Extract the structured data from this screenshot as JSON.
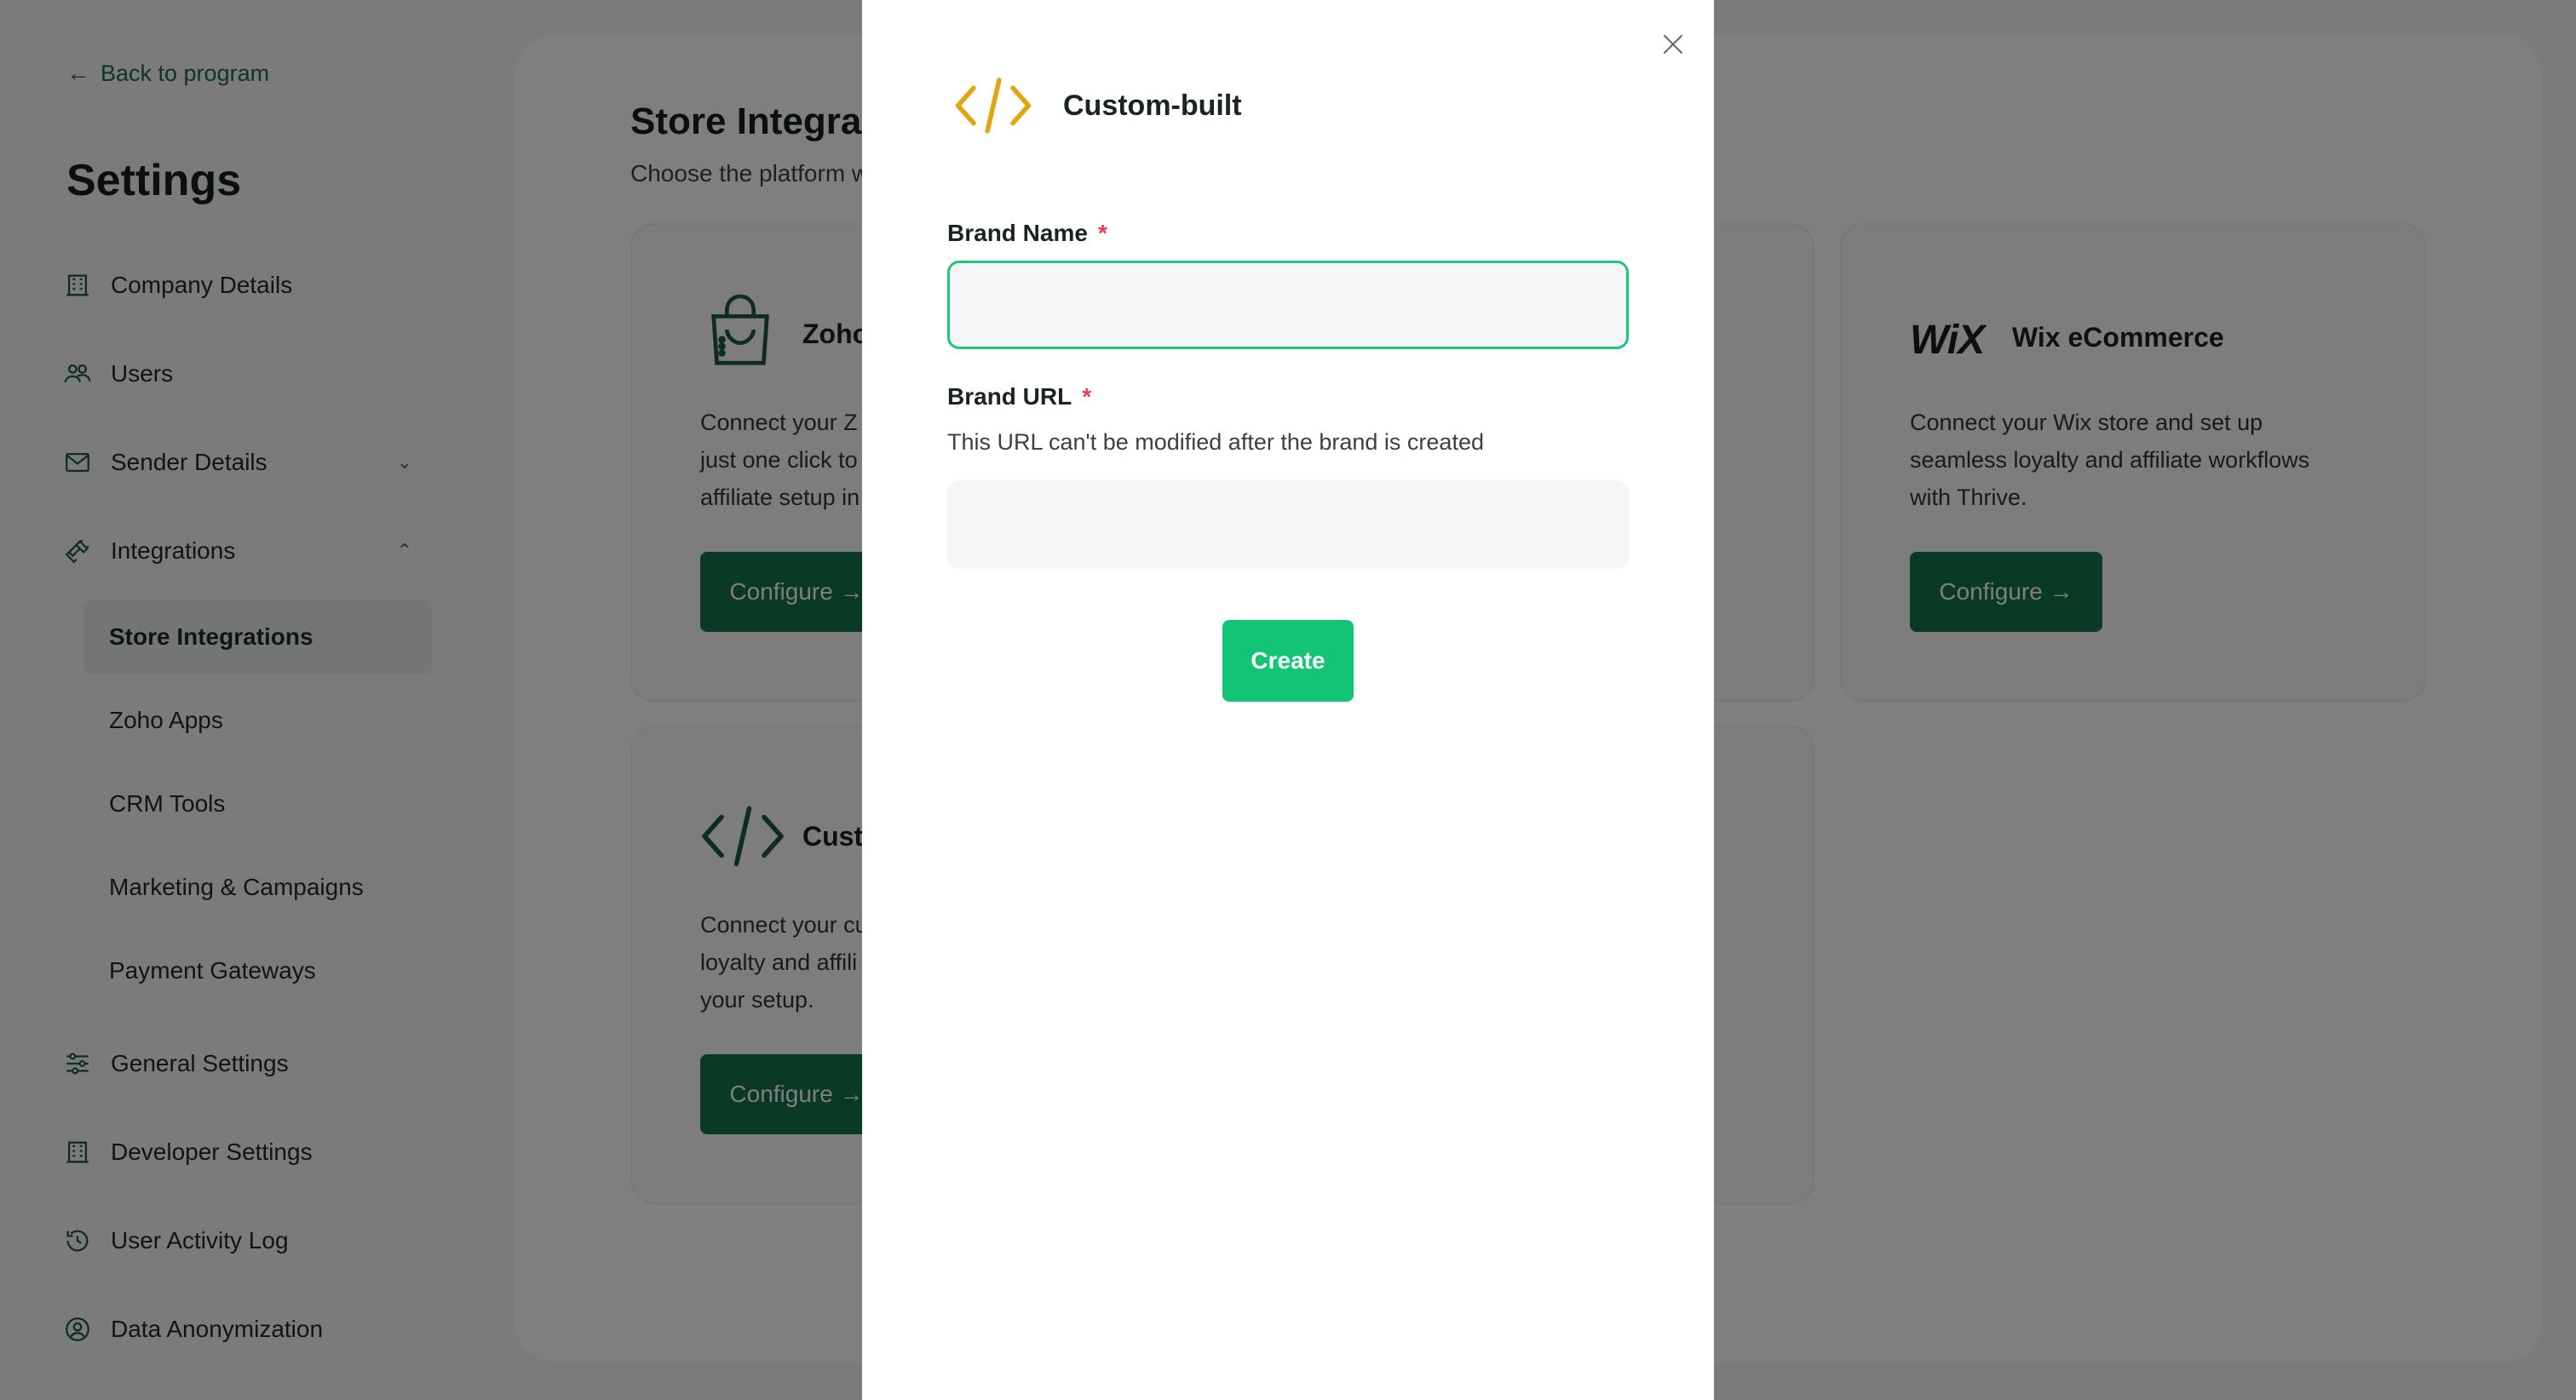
{
  "sidebar": {
    "back_label": "Back to program",
    "title": "Settings",
    "items": [
      {
        "label": "Company Details"
      },
      {
        "label": "Users"
      },
      {
        "label": "Sender Details"
      },
      {
        "label": "Integrations"
      },
      {
        "label": "General Settings"
      },
      {
        "label": "Developer Settings"
      },
      {
        "label": "User Activity Log"
      },
      {
        "label": "Data Anonymization"
      }
    ],
    "sub_items": [
      {
        "label": "Store Integrations"
      },
      {
        "label": "Zoho Apps"
      },
      {
        "label": "CRM Tools"
      },
      {
        "label": "Marketing & Campaigns"
      },
      {
        "label": "Payment Gateways"
      }
    ]
  },
  "main": {
    "title": "Store Integrat",
    "subtitle": "Choose the platform w",
    "cards": [
      {
        "name": "Zoho",
        "desc_lines": [
          "Connect your Z",
          "just one click to",
          "affiliate setup in"
        ],
        "button": "Configure →"
      },
      {
        "name": "Wix eCommerce",
        "logo_text": "WiX",
        "desc_lines": [
          "Connect your Wix store and set up",
          "seamless loyalty and affiliate workflows",
          "with Thrive."
        ],
        "button": "Configure →"
      },
      {
        "name": "Custo",
        "desc_lines": [
          "Connect your cu",
          "loyalty and affili",
          "your setup."
        ],
        "button": "Configure →"
      }
    ]
  },
  "modal": {
    "title": "Custom-built",
    "brand_name_label": "Brand Name",
    "brand_name_value": "",
    "brand_url_label": "Brand URL",
    "brand_url_hint": "This URL can't be modified after the brand is created",
    "brand_url_value": "",
    "required_mark": "*",
    "create_label": "Create"
  },
  "colors": {
    "brand_green": "#15724a",
    "accent_green": "#12c474",
    "icon_gold": "#e2a50f",
    "required_red": "#e0405a"
  }
}
